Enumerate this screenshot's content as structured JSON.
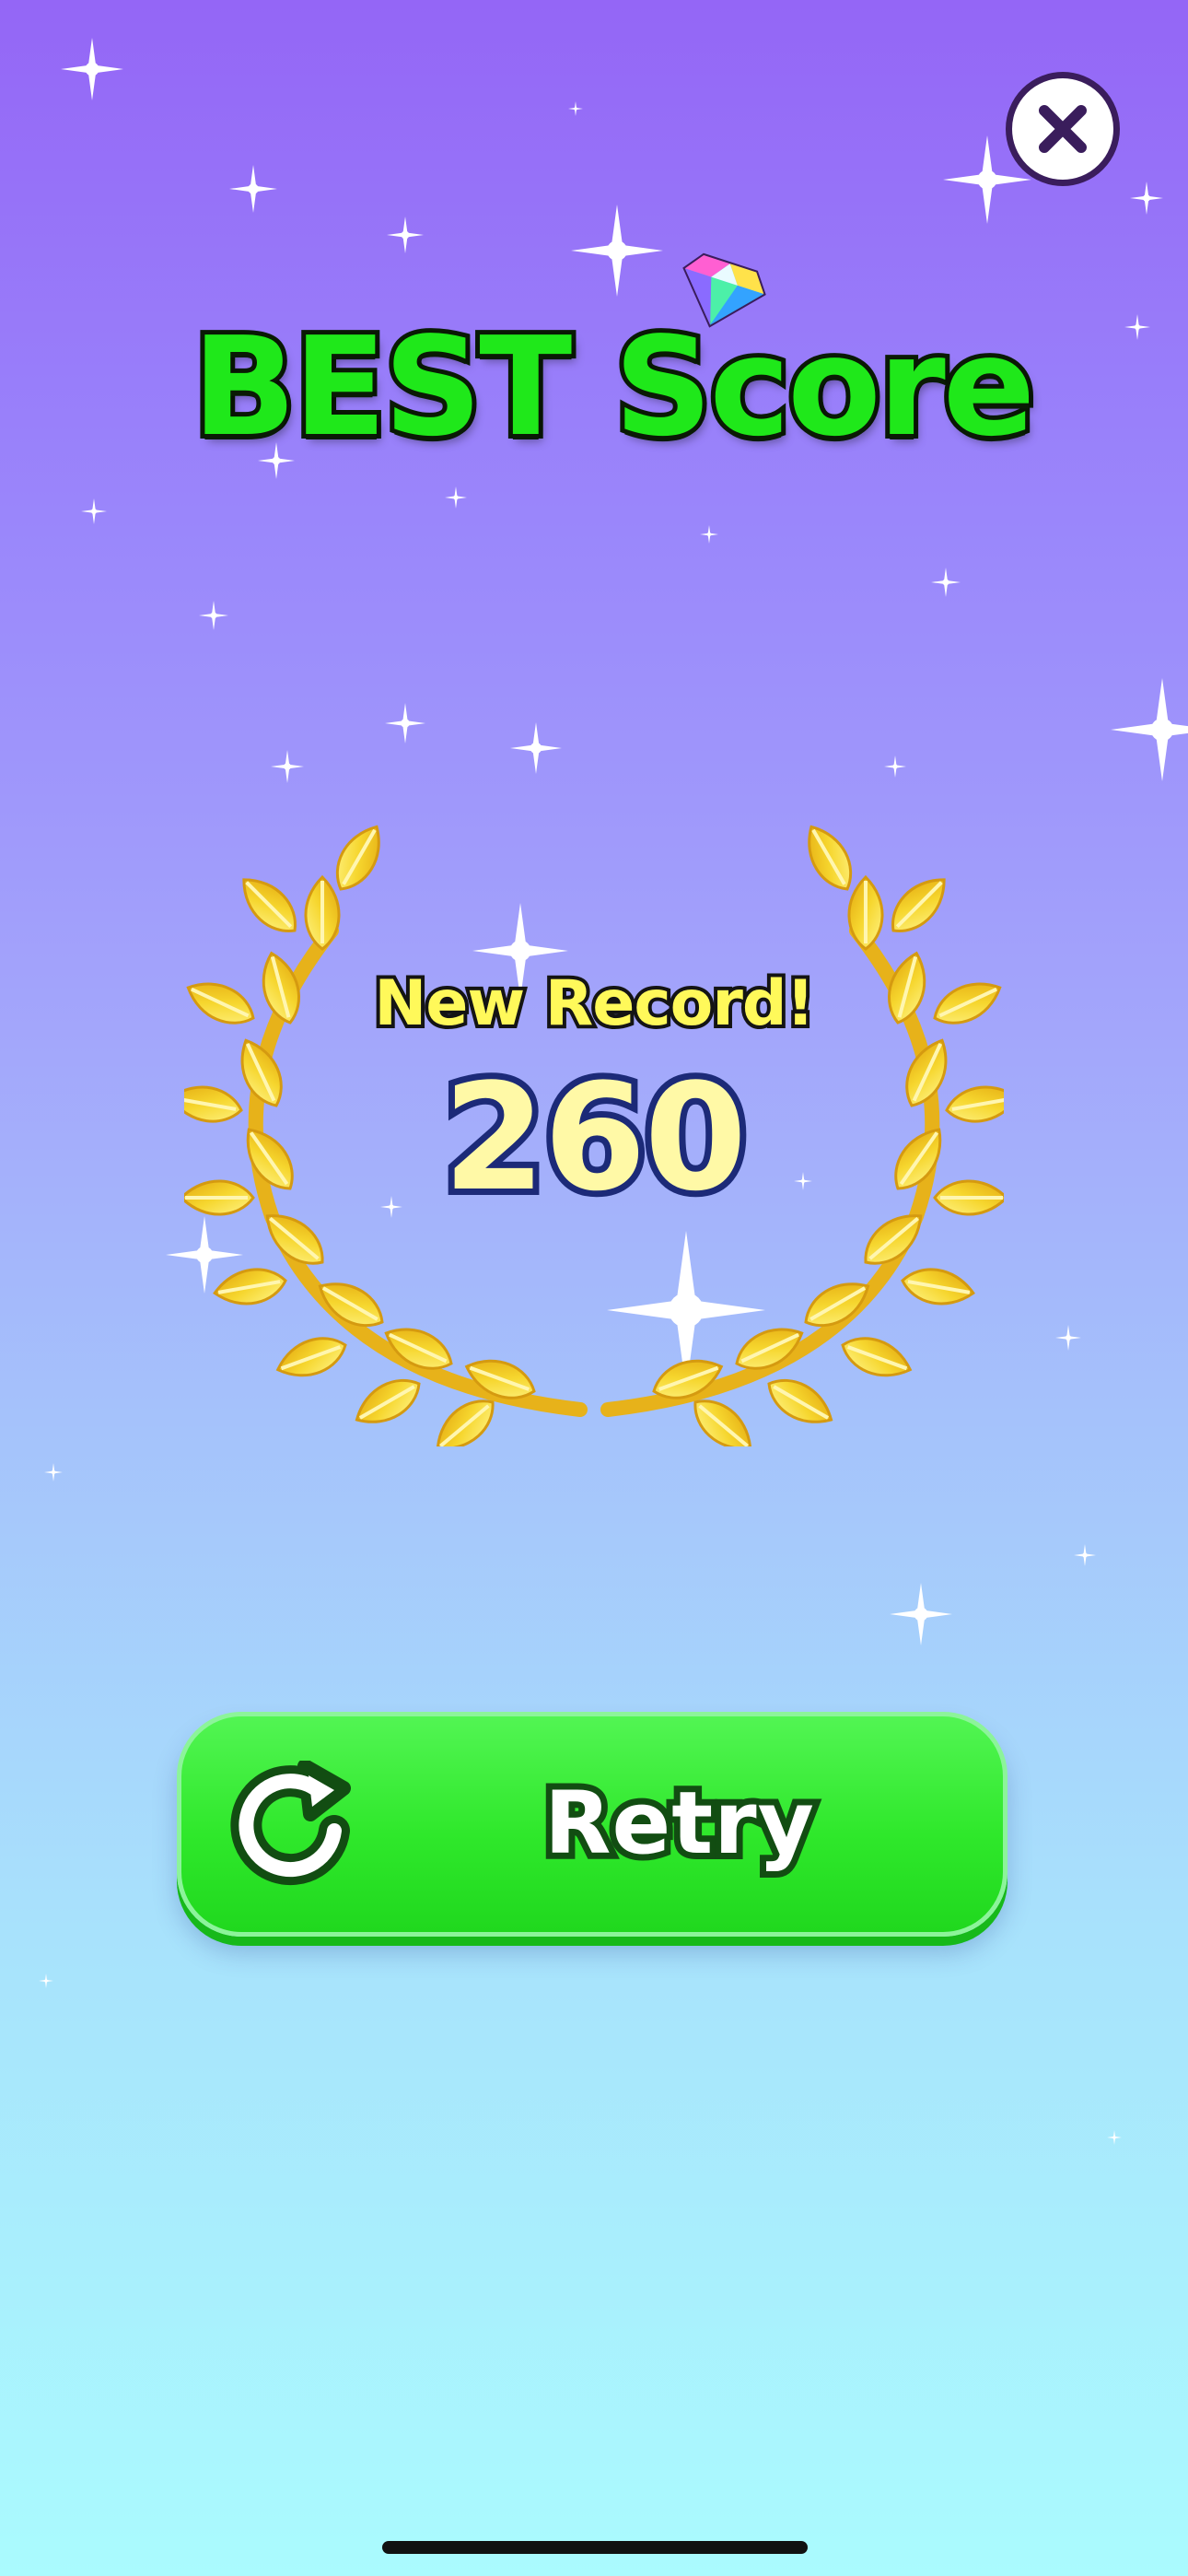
{
  "screen": {
    "title": "BEST Score",
    "record_label": "New Record!",
    "score": "260",
    "retry_label": "Retry"
  },
  "icons": {
    "close": "close-icon",
    "gem": "gem-icon",
    "laurel": "laurel-wreath-icon",
    "retry": "retry-arrow-icon"
  },
  "colors": {
    "title_green": "#1fe81a",
    "button_green": "#2fe82b",
    "laurel_gold": "#f6d62e",
    "score_fill": "#fff9a6",
    "score_outline": "#1c2a78",
    "record_yellow": "#fff95a",
    "bg_top": "#9466f6",
    "bg_bottom": "#aafbfe"
  }
}
